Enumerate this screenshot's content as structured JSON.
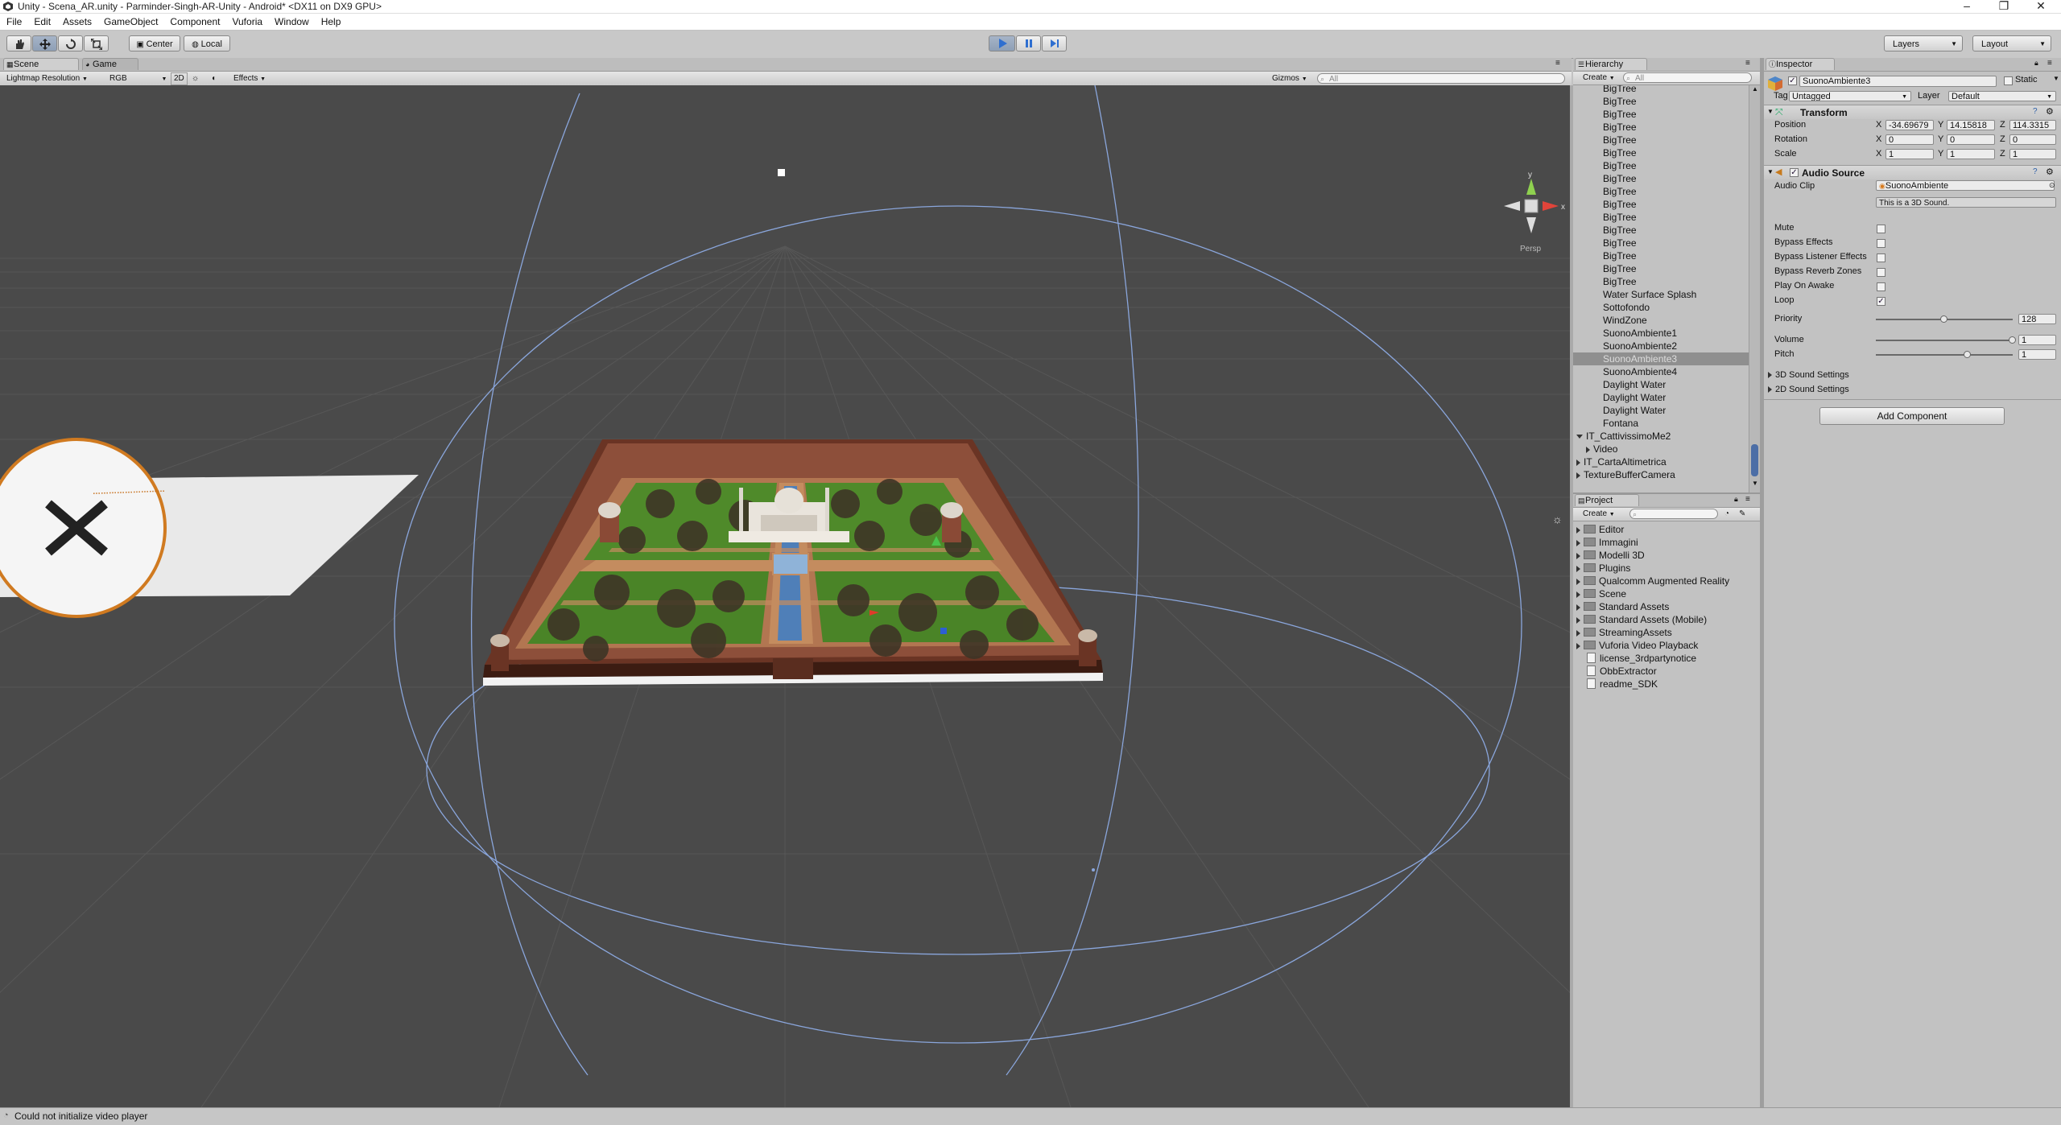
{
  "window": {
    "title": "Unity - Scena_AR.unity - Parminder-Singh-AR-Unity - Android* <DX11 on DX9 GPU>",
    "minimize_glyph": "–",
    "restore_glyph": "❐",
    "close_glyph": "✕"
  },
  "menu": [
    "File",
    "Edit",
    "Assets",
    "GameObject",
    "Component",
    "Vuforia",
    "Window",
    "Help"
  ],
  "toolbar": {
    "pivot_label": "Center",
    "space_label": "Local",
    "layers_label": "Layers",
    "layout_label": "Layout",
    "play_active": true
  },
  "scene_panel": {
    "tabs": [
      "Scene",
      "Game"
    ],
    "render_mode": "Lightmap Resolution",
    "color_mode": "RGB",
    "mode_2d": "2D",
    "effects": "Effects",
    "gizmos": "Gizmos",
    "search_placeholder": "All",
    "persp_label": "Persp",
    "gizmo_axis_y": "y",
    "gizmo_axis_x": "x"
  },
  "hierarchy": {
    "title": "Hierarchy",
    "create_label": "Create",
    "search_placeholder": "All",
    "items": [
      {
        "label": "BigTree",
        "indent": 2
      },
      {
        "label": "BigTree",
        "indent": 2
      },
      {
        "label": "BigTree",
        "indent": 2
      },
      {
        "label": "BigTree",
        "indent": 2
      },
      {
        "label": "BigTree",
        "indent": 2
      },
      {
        "label": "BigTree",
        "indent": 2
      },
      {
        "label": "BigTree",
        "indent": 2
      },
      {
        "label": "BigTree",
        "indent": 2
      },
      {
        "label": "BigTree",
        "indent": 2
      },
      {
        "label": "BigTree",
        "indent": 2
      },
      {
        "label": "BigTree",
        "indent": 2
      },
      {
        "label": "BigTree",
        "indent": 2
      },
      {
        "label": "BigTree",
        "indent": 2
      },
      {
        "label": "BigTree",
        "indent": 2
      },
      {
        "label": "BigTree",
        "indent": 2
      },
      {
        "label": "BigTree",
        "indent": 2
      },
      {
        "label": "Water Surface Splash",
        "indent": 2
      },
      {
        "label": "Sottofondo",
        "indent": 2
      },
      {
        "label": "WindZone",
        "indent": 2
      },
      {
        "label": "SuonoAmbiente1",
        "indent": 2
      },
      {
        "label": "SuonoAmbiente2",
        "indent": 2
      },
      {
        "label": "SuonoAmbiente3",
        "indent": 2,
        "selected": true
      },
      {
        "label": "SuonoAmbiente4",
        "indent": 2
      },
      {
        "label": "Daylight Water",
        "indent": 2
      },
      {
        "label": "Daylight Water",
        "indent": 2
      },
      {
        "label": "Daylight Water",
        "indent": 2
      },
      {
        "label": "Fontana",
        "indent": 2
      },
      {
        "label": "IT_CattivissimoMe2",
        "indent": 0,
        "expander": "down"
      },
      {
        "label": "Video",
        "indent": 1,
        "expander": "right"
      },
      {
        "label": "IT_CartaAltimetrica",
        "indent": 0,
        "expander": "right"
      },
      {
        "label": "TextureBufferCamera",
        "indent": 0,
        "expander": "right"
      }
    ]
  },
  "project": {
    "title": "Project",
    "create_label": "Create",
    "items": [
      {
        "label": "Editor",
        "kind": "folder"
      },
      {
        "label": "Immagini",
        "kind": "folder"
      },
      {
        "label": "Modelli 3D",
        "kind": "folder"
      },
      {
        "label": "Plugins",
        "kind": "folder"
      },
      {
        "label": "Qualcomm Augmented Reality",
        "kind": "folder"
      },
      {
        "label": "Scene",
        "kind": "folder"
      },
      {
        "label": "Standard Assets",
        "kind": "folder"
      },
      {
        "label": "Standard Assets (Mobile)",
        "kind": "folder"
      },
      {
        "label": "StreamingAssets",
        "kind": "folder"
      },
      {
        "label": "Vuforia Video Playback",
        "kind": "folder"
      },
      {
        "label": "license_3rdpartynotice",
        "kind": "file"
      },
      {
        "label": "ObbExtractor",
        "kind": "file"
      },
      {
        "label": "readme_SDK",
        "kind": "file"
      }
    ]
  },
  "inspector": {
    "title": "Inspector",
    "object_name": "SuonoAmbiente3",
    "static_label": "Static",
    "tag_label": "Tag",
    "tag_value": "Untagged",
    "layer_label": "Layer",
    "layer_value": "Default",
    "transform": {
      "title": "Transform",
      "position_label": "Position",
      "rotation_label": "Rotation",
      "scale_label": "Scale",
      "axis_x": "X",
      "axis_y": "Y",
      "axis_z": "Z",
      "position": [
        "-34.69679",
        "14.15818",
        "114.3315"
      ],
      "rotation": [
        "0",
        "0",
        "0"
      ],
      "scale": [
        "1",
        "1",
        "1"
      ]
    },
    "audio_source": {
      "title": "Audio Source",
      "clip_label": "Audio Clip",
      "clip_value": "SuonoAmbiente",
      "info": "This is a 3D Sound.",
      "toggles": [
        {
          "label": "Mute",
          "checked": false
        },
        {
          "label": "Bypass Effects",
          "checked": false
        },
        {
          "label": "Bypass Listener Effects",
          "checked": false
        },
        {
          "label": "Bypass Reverb Zones",
          "checked": false
        },
        {
          "label": "Play On Awake",
          "checked": false
        },
        {
          "label": "Loop",
          "checked": true
        }
      ],
      "priority_label": "Priority",
      "priority_value": "128",
      "priority_fraction": 0.5,
      "volume_label": "Volume",
      "volume_value": "1",
      "volume_fraction": 1.0,
      "pitch_label": "Pitch",
      "pitch_value": "1",
      "pitch_fraction": 0.67,
      "sound3d_label": "3D Sound Settings",
      "sound2d_label": "2D Sound Settings"
    },
    "add_component_label": "Add Component"
  },
  "status": {
    "message": "Could not initialize video player"
  },
  "colors": {
    "scene_bg": "#4a4a4a",
    "grass": "#4f8a2a",
    "path": "#b57a52",
    "wall": "#5a2d1f",
    "water": "#4f7fb8",
    "gizmo_sphere": "#7f9ed6",
    "play_accent": "#5b8fd6"
  }
}
